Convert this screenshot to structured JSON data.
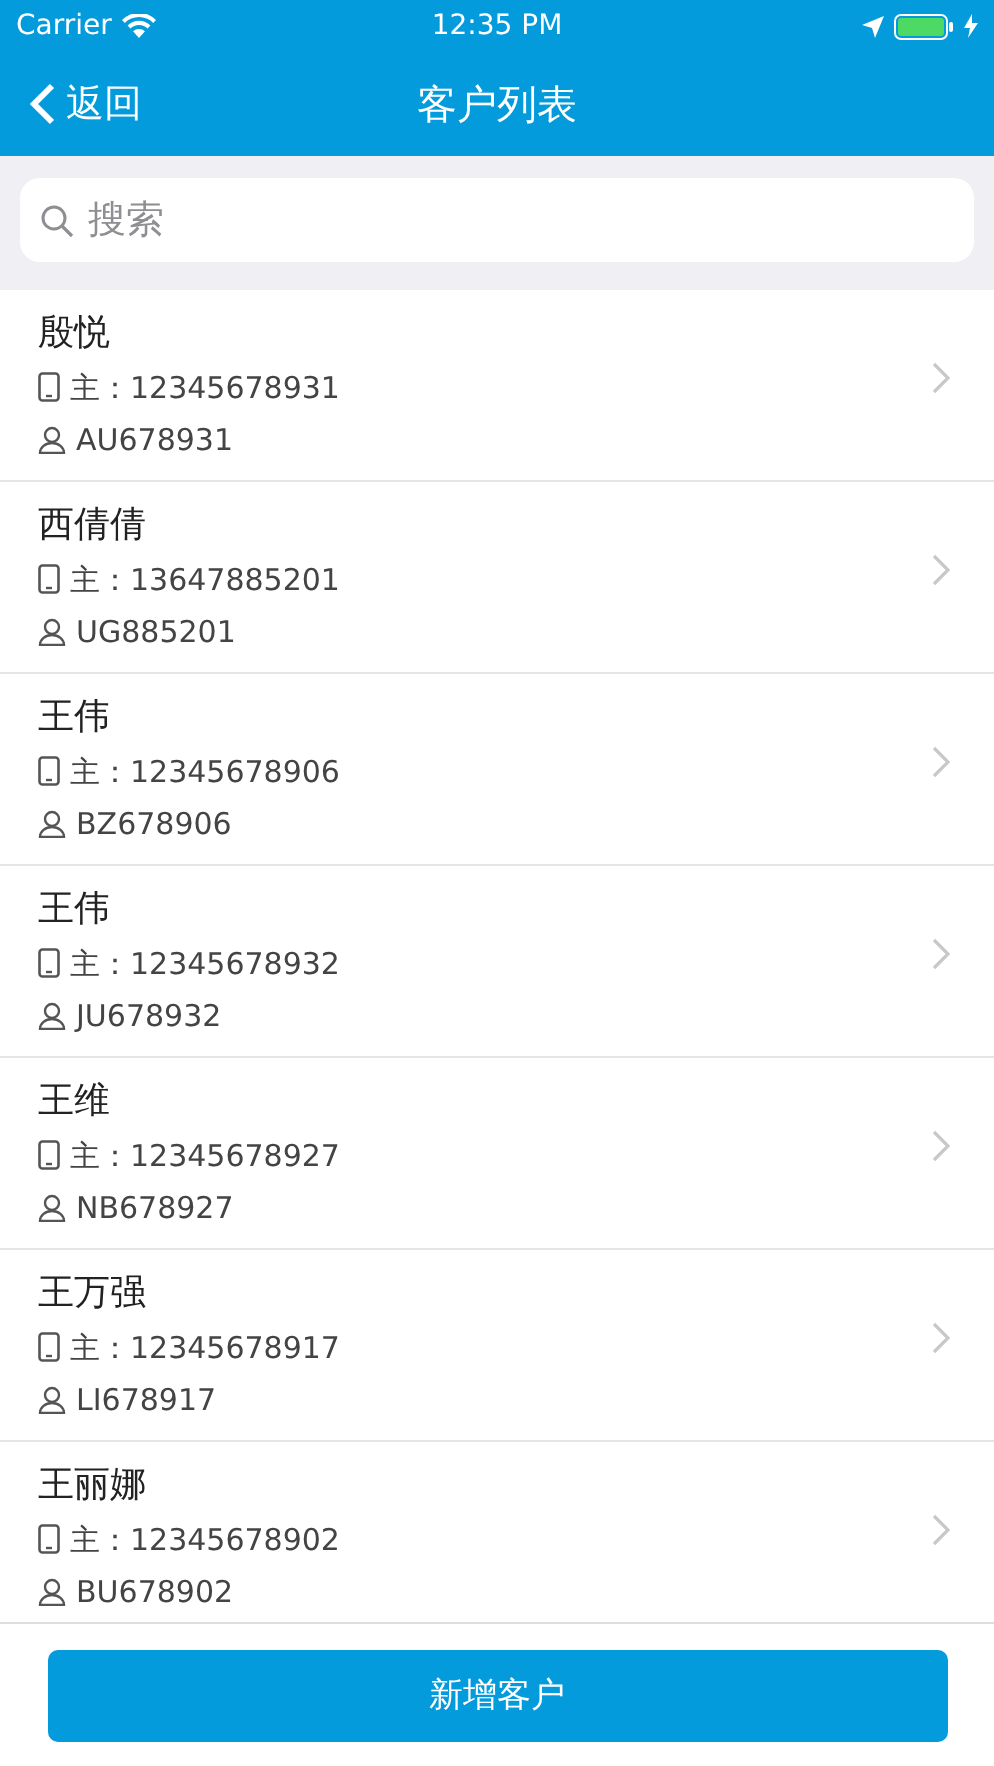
{
  "status_bar": {
    "carrier": "Carrier",
    "time": "12:35 PM"
  },
  "nav": {
    "back": "返回",
    "title": "客户列表"
  },
  "search": {
    "placeholder": "搜索"
  },
  "customers": [
    {
      "name": "殷悦",
      "phone": "主：12345678931",
      "code": "AU678931"
    },
    {
      "name": "西倩倩",
      "phone": "主：13647885201",
      "code": "UG885201"
    },
    {
      "name": "王伟",
      "phone": "主：12345678906",
      "code": "BZ678906"
    },
    {
      "name": "王伟",
      "phone": "主：12345678932",
      "code": "JU678932"
    },
    {
      "name": "王维",
      "phone": "主：12345678927",
      "code": "NB678927"
    },
    {
      "name": "王万强",
      "phone": "主：12345678917",
      "code": "LI678917"
    },
    {
      "name": "王丽娜",
      "phone": "主：12345678902",
      "code": "BU678902"
    }
  ],
  "footer": {
    "button": "新增客户"
  }
}
